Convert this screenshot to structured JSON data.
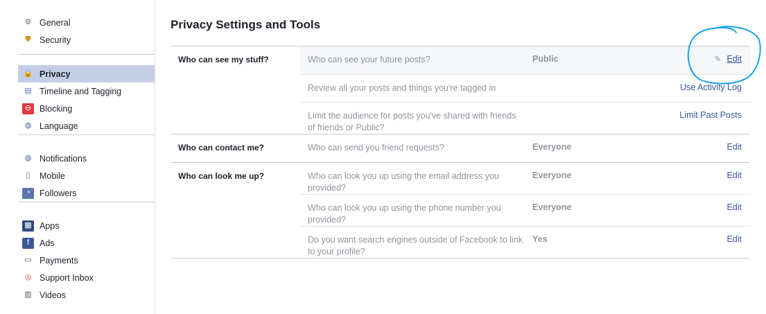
{
  "sidebar": {
    "groups": [
      [
        {
          "label": "General",
          "icon": "gears-icon"
        },
        {
          "label": "Security",
          "icon": "badge-icon"
        }
      ],
      [
        {
          "label": "Privacy",
          "icon": "lock-icon",
          "active": true
        },
        {
          "label": "Timeline and Tagging",
          "icon": "timeline-icon"
        },
        {
          "label": "Blocking",
          "icon": "block-icon"
        },
        {
          "label": "Language",
          "icon": "globe-icon"
        }
      ],
      [
        {
          "label": "Notifications",
          "icon": "globe-notify-icon"
        },
        {
          "label": "Mobile",
          "icon": "phone-icon"
        },
        {
          "label": "Followers",
          "icon": "rss-icon"
        }
      ],
      [
        {
          "label": "Apps",
          "icon": "apps-icon"
        },
        {
          "label": "Ads",
          "icon": "ads-icon"
        },
        {
          "label": "Payments",
          "icon": "card-icon"
        },
        {
          "label": "Support Inbox",
          "icon": "lifebuoy-icon"
        },
        {
          "label": "Videos",
          "icon": "film-icon"
        }
      ]
    ]
  },
  "main": {
    "title": "Privacy Settings and Tools",
    "sections": [
      {
        "label": "Who can see my stuff?",
        "rows": [
          {
            "question": "Who can see your future posts?",
            "value": "Public",
            "action": "Edit",
            "highlighted": true,
            "pencil": true
          },
          {
            "question": "Review all your posts and things you're tagged in",
            "value": "",
            "action": "Use Activity Log"
          },
          {
            "question": "Limit the audience for posts you've shared with friends of friends or Public?",
            "value": "",
            "action": "Limit Past Posts"
          }
        ]
      },
      {
        "label": "Who can contact me?",
        "rows": [
          {
            "question": "Who can send you friend requests?",
            "value": "Everyone",
            "action": "Edit"
          }
        ]
      },
      {
        "label": "Who can look me up?",
        "rows": [
          {
            "question": "Who can look you up using the email address you provided?",
            "value": "Everyone",
            "action": "Edit"
          },
          {
            "question": "Who can look you up using the phone number you provided?",
            "value": "Everyone",
            "action": "Edit"
          },
          {
            "question": "Do you want search engines outside of Facebook to link to your profile?",
            "value": "Yes",
            "action": "Edit"
          }
        ]
      }
    ]
  },
  "colors": {
    "link": "#365899",
    "muted": "#90949c",
    "active_bg": "#c4cfe6",
    "annotation": "#1aa3e8"
  }
}
